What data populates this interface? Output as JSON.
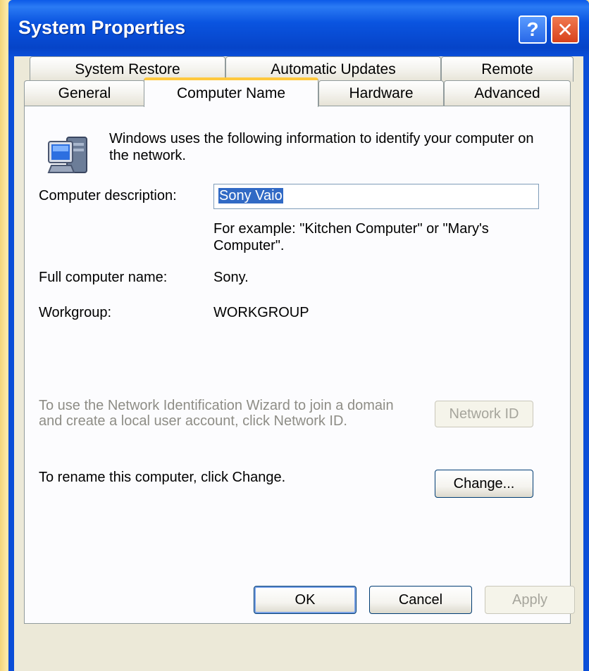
{
  "window": {
    "title": "System Properties",
    "help_glyph": "?",
    "close_glyph": "✕"
  },
  "tabs": {
    "row1": [
      "System Restore",
      "Automatic Updates",
      "Remote"
    ],
    "row2": [
      "General",
      "Computer Name",
      "Hardware",
      "Advanced"
    ],
    "active": "Computer Name"
  },
  "content": {
    "intro": "Windows uses the following information to identify your computer on the network.",
    "description_label": "Computer description:",
    "description_value": "Sony Vaio",
    "example": "For example: \"Kitchen Computer\" or \"Mary's Computer\".",
    "fullname_label": "Full computer name:",
    "fullname_value": "Sony.",
    "workgroup_label": "Workgroup:",
    "workgroup_value": "WORKGROUP",
    "wizard_text": "To use the Network Identification Wizard to join a domain and create a local user account, click Network ID.",
    "network_id_button": "Network ID",
    "rename_text": "To rename this computer, click Change.",
    "change_button": "Change..."
  },
  "footer": {
    "ok": "OK",
    "cancel": "Cancel",
    "apply": "Apply"
  },
  "colors": {
    "titlebar": "#0a54e0",
    "dialog_bg": "#ece9d8",
    "active_tab_accent": "#ffc83c",
    "selection": "#316ac5",
    "disabled_text": "#8e8d86"
  }
}
